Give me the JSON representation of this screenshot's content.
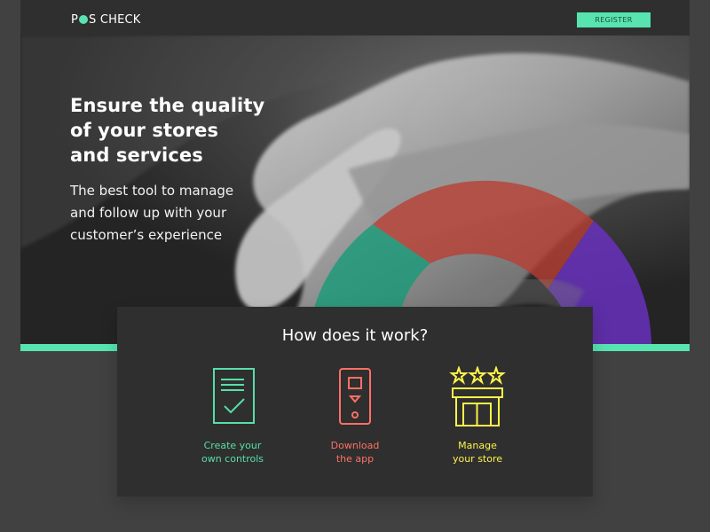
{
  "brand": {
    "name_prefix": "P",
    "name_suffix": "S CHECK",
    "accent_color": "#57e4b0"
  },
  "header": {
    "register_label": "REGISTER"
  },
  "hero": {
    "title_line_1": "Ensure the quality",
    "title_line_2": "of your stores",
    "title_line_3": "and services",
    "subtitle_line_1": "The best tool to manage",
    "subtitle_line_2": "and follow up with your",
    "subtitle_line_3": "customer’s experience"
  },
  "how_it_works": {
    "heading": "How does it work?",
    "items": [
      {
        "line_1": "Create your",
        "line_2": "own controls",
        "icon": "document-check-icon",
        "color": "#56dfa8"
      },
      {
        "line_1": "Download",
        "line_2": "the app",
        "icon": "mobile-download-icon",
        "color": "#ff7064"
      },
      {
        "line_1": "Manage",
        "line_2": "your store",
        "icon": "store-rating-icon",
        "color": "#fff34a"
      }
    ]
  }
}
